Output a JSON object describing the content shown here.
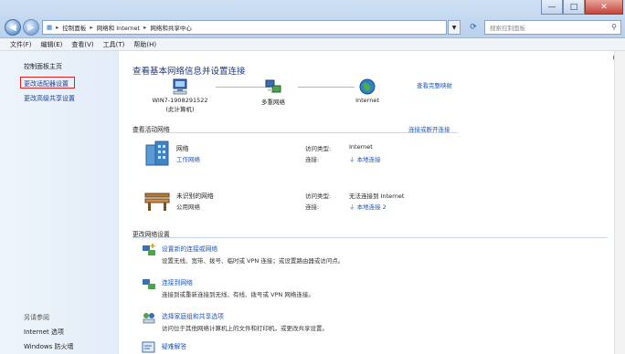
{
  "window": {
    "minimize": "—",
    "maximize": "□",
    "close": "✕"
  },
  "address": {
    "crumbs": [
      "控制面板",
      "网络和 Internet",
      "网络和共享中心"
    ],
    "search_placeholder": "搜索控制面板"
  },
  "menu": {
    "items": [
      "文件(F)",
      "编辑(E)",
      "查看(V)",
      "工具(T)",
      "帮助(H)"
    ]
  },
  "sidebar": {
    "items": [
      "控制面板主页",
      "更改适配器设置",
      "更改高级共享设置"
    ],
    "see_also": "另请参阅",
    "bottom": [
      "Internet 选项",
      "Windows 防火墙"
    ]
  },
  "main": {
    "title": "查看基本网络信息并设置连接",
    "full_map": "查看完整映射",
    "map_nodes": [
      {
        "label": "WIN7-1908291522",
        "sub": "(此计算机)",
        "icon": "computer-icon"
      },
      {
        "label": "多重网络",
        "sub": "",
        "icon": "network-icon"
      },
      {
        "label": "Internet",
        "sub": "",
        "icon": "globe-icon"
      }
    ],
    "active_head": "查看活动网络",
    "connect_disconnect": "连接或断开连接",
    "networks": [
      {
        "name": "网络",
        "type": "工作网络",
        "access_label": "访问类型:",
        "access": "Internet",
        "conn_label": "连接:",
        "conn": "本地连接",
        "icon": "building-icon"
      },
      {
        "name": "未识别的网络",
        "type": "公用网络",
        "access_label": "访问类型:",
        "access": "无法连接到 Internet",
        "conn_label": "连接:",
        "conn": "本地连接 2",
        "icon": "bench-icon"
      }
    ],
    "change_head": "更改网络设置",
    "tasks": [
      {
        "title": "设置新的连接或网络",
        "desc": "设置无线、宽带、拨号、临时或 VPN 连接；或设置路由器或访问点。",
        "icon": "new-connection-icon"
      },
      {
        "title": "连接到网络",
        "desc": "连接到或重新连接到无线、有线、拨号或 VPN 网络连接。",
        "icon": "connect-network-icon"
      },
      {
        "title": "选择家庭组和共享选项",
        "desc": "访问位于其他网络计算机上的文件和打印机，或更改共享设置。",
        "icon": "homegroup-icon"
      },
      {
        "title": "疑难解答",
        "desc": "",
        "icon": "troubleshoot-icon"
      }
    ]
  },
  "colors": {
    "link": "#1d56b8",
    "highlight_box": "#e02020",
    "sidebar_bg": "#eef4fb"
  }
}
